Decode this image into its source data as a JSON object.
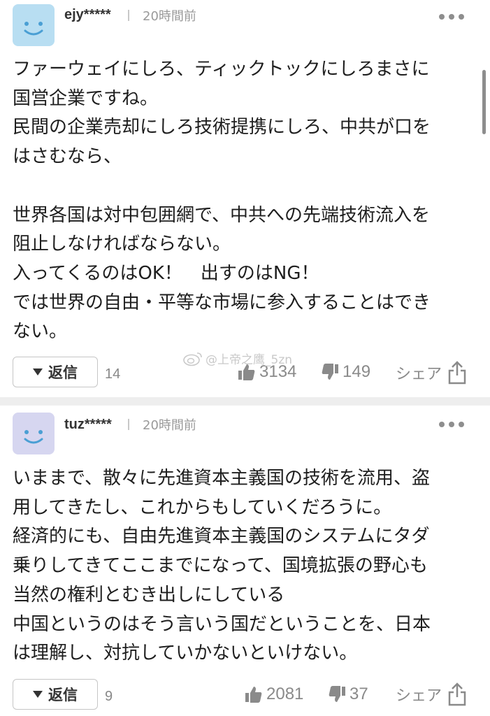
{
  "comments": [
    {
      "username": "ejy*****",
      "separator": "|",
      "time": "20時間前",
      "avatar_color": "#b8def2",
      "body": "ファーウェイにしろ、ティックトックにしろまさに\n国営企業ですね。\n民間の企業売却にしろ技術提携にしろ、中共が口を\nはさむなら、\n\n世界各国は対中包囲網で、中共への先端技術流入を\n阻止しなければならない。\n入ってくるのはOK！　出すのはNG！\nでは世界の自由・平等な市場に参入することはでき\nない。",
      "reply_label": "返信",
      "reply_count": "14",
      "likes": "3134",
      "dislikes": "149",
      "share_label": "シェア"
    },
    {
      "username": "tuz*****",
      "separator": "|",
      "time": "20時間前",
      "avatar_color": "#d6d6f0",
      "body": "いままで、散々に先進資本主義国の技術を流用、盗\n用してきたし、これからもしていくだろうに。\n経済的にも、自由先進資本主義国のシステムにタダ\n乗りしてきてここまでになって、国境拡張の野心も\n当然の権利とむき出しにしている\n中国というのはそう言いう国だということを、日本\nは理解し、対抗していかないといけない。",
      "reply_label": "返信",
      "reply_count": "9",
      "likes": "2081",
      "dislikes": "37",
      "share_label": "シェア"
    }
  ],
  "watermark": "@上帝之鹰_5zn",
  "colors": {
    "text": "#1e1e1e",
    "muted": "#8a8a8a",
    "separator_band": "#eeeeee"
  }
}
